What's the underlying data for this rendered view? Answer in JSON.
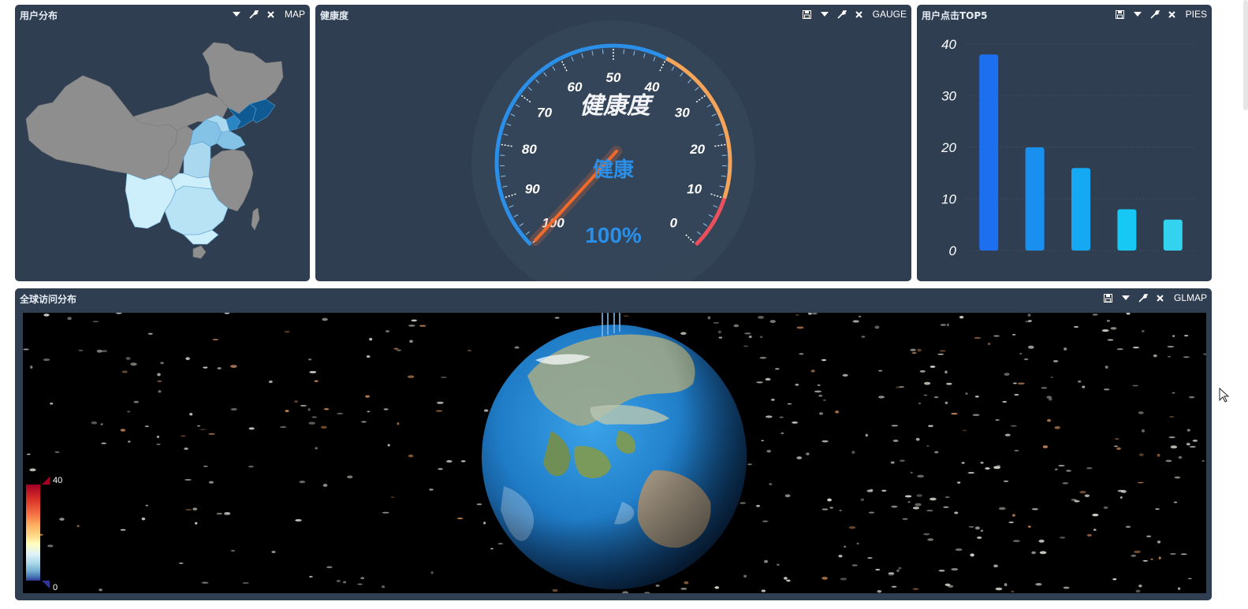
{
  "colors": {
    "panel_bg": "#2f3e51",
    "map_gray": "#8e8e8e",
    "map_blues": [
      "#cdeefb",
      "#a9d8ef",
      "#84c3e6",
      "#2b85c3",
      "#105a94"
    ],
    "gauge_blue": "#2b8fe8",
    "gauge_orange": "#f5a55a",
    "gauge_red": "#e9505b",
    "bar_colors": [
      "#1e6ff0",
      "#198ff0",
      "#15a8f3",
      "#17c8f4",
      "#33d3ef"
    ],
    "legend_top": "#a50026",
    "legend_bottom": "#313695"
  },
  "panels": {
    "map": {
      "title": "用户分布",
      "type_label": "MAP",
      "icons": [
        "dropdown-icon",
        "wrench-icon",
        "close-icon"
      ]
    },
    "gauge": {
      "title": "健康度",
      "type_label": "GAUGE",
      "icons": [
        "save-icon",
        "dropdown-icon",
        "wrench-icon",
        "close-icon"
      ],
      "gauge_title": "健康度",
      "detail_label": "健康",
      "value_text": "100%",
      "tick_labels": [
        "100",
        "90",
        "80",
        "70",
        "60",
        "50",
        "40",
        "30",
        "20",
        "10",
        "0"
      ]
    },
    "bars": {
      "title": "用户点击TOP5",
      "type_label": "PIES",
      "icons": [
        "save-icon",
        "dropdown-icon",
        "wrench-icon",
        "close-icon"
      ]
    },
    "globe": {
      "title": "全球访问分布",
      "type_label": "GLMAP",
      "icons": [
        "save-icon",
        "dropdown-icon",
        "wrench-icon",
        "close-icon"
      ],
      "legend_max": "40",
      "legend_min": "0"
    }
  },
  "chart_data": [
    {
      "type": "bar",
      "categories": [
        "",
        "",
        "",
        "",
        ""
      ],
      "values": [
        38,
        20,
        16,
        8,
        6
      ],
      "ylim": [
        0,
        40
      ],
      "y_ticks": [
        "0",
        "10",
        "20",
        "30",
        "40"
      ],
      "grid": true
    },
    {
      "type": "gauge",
      "value": 100,
      "min": 0,
      "max": 100,
      "reversed": true
    }
  ]
}
